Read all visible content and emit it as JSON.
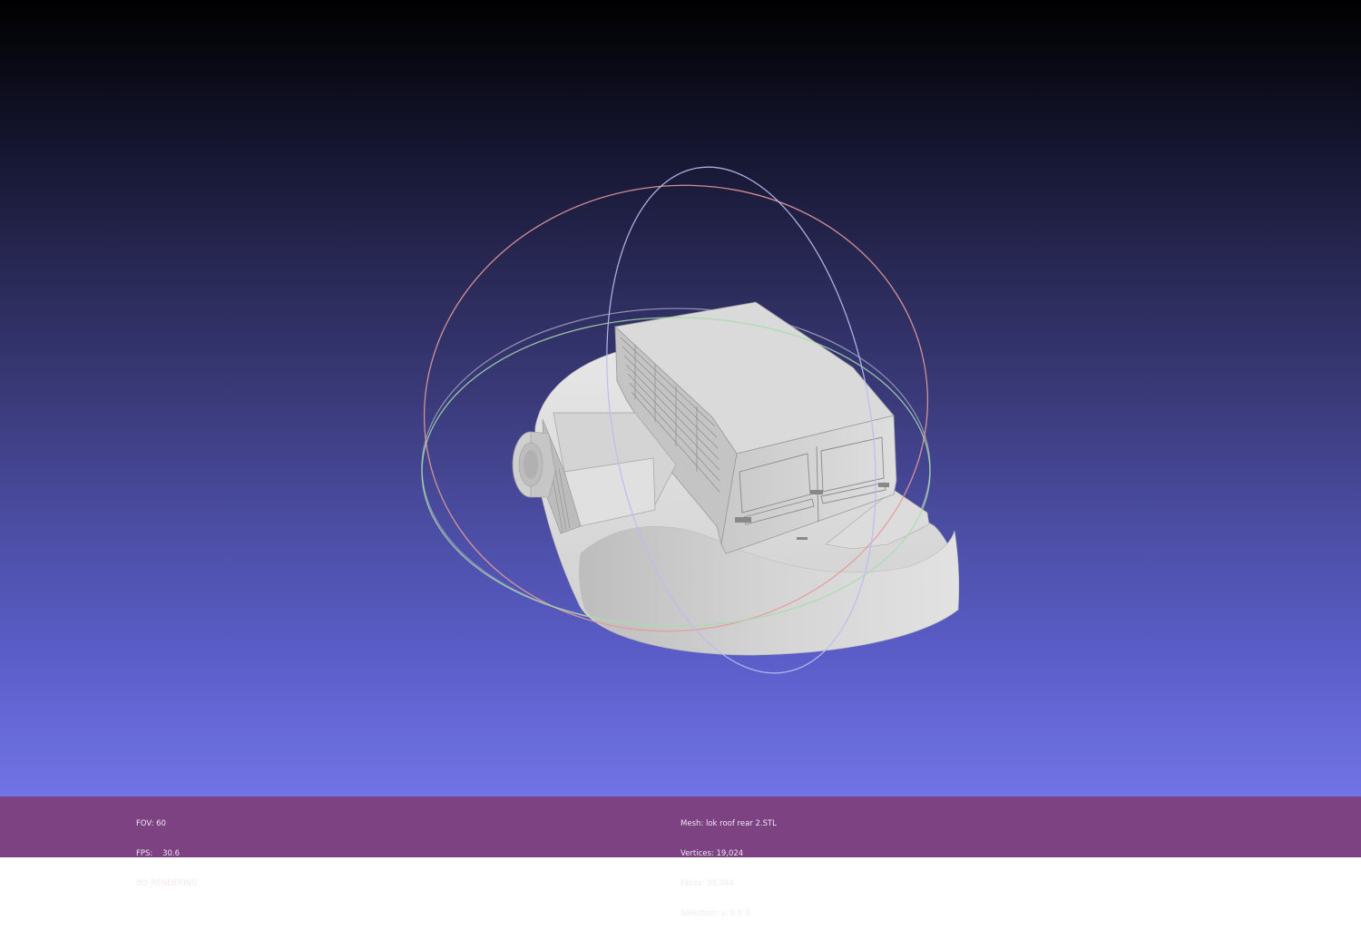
{
  "colors": {
    "background_top": "#000000",
    "background_bottom": "#7274e6",
    "infobar": "#7d4281",
    "mesh": "#d8d8d8",
    "trackball_x": "#e59a9a",
    "trackball_y": "#9ad89a",
    "trackball_z": "#b7b7f0"
  },
  "scene": {
    "trackball_icon": "trackball-gizmo",
    "mesh_icon": "loco-roof-rear-mesh"
  },
  "info_left": {
    "fov": "FOV: 60",
    "fps": "FPS:    30.6",
    "render_mode": "BO_RENDERING"
  },
  "info_right": {
    "mesh": "Mesh: lok roof rear 2.STL",
    "vertices": "Vertices: 19,024",
    "faces": "Faces: 38,044",
    "selection": "Selection: v: 0 f: 0"
  }
}
